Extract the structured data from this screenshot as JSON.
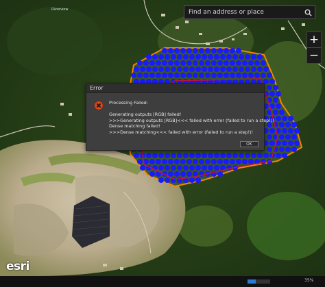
{
  "map": {
    "place_label": "Riverview",
    "search": {
      "placeholder": "Find an address or place",
      "icon": "search-icon"
    },
    "zoom": {
      "in_label": "+",
      "out_label": "−"
    },
    "attribution": "esri",
    "survey_points": {
      "colour": "#1a1aff",
      "boundary_colour": "#ff8a00",
      "flight_path_colour": "#c0143c"
    }
  },
  "dialog": {
    "title": "Error",
    "icon": "error-icon",
    "messages": [
      "Processing Failed:",
      "",
      "Generating outputs [RGB] failed!",
      ">>>Generating outputs [RGB]<<< failed with error (failed to run a step!)!",
      "Dense matching failed!",
      ">>>Dense matching<<< failed with error (failed to run a step!)!"
    ],
    "ok_label": "OK"
  },
  "status": {
    "progress_percent": 35,
    "progress_label": "35%",
    "accent": "#2a7bd6"
  }
}
